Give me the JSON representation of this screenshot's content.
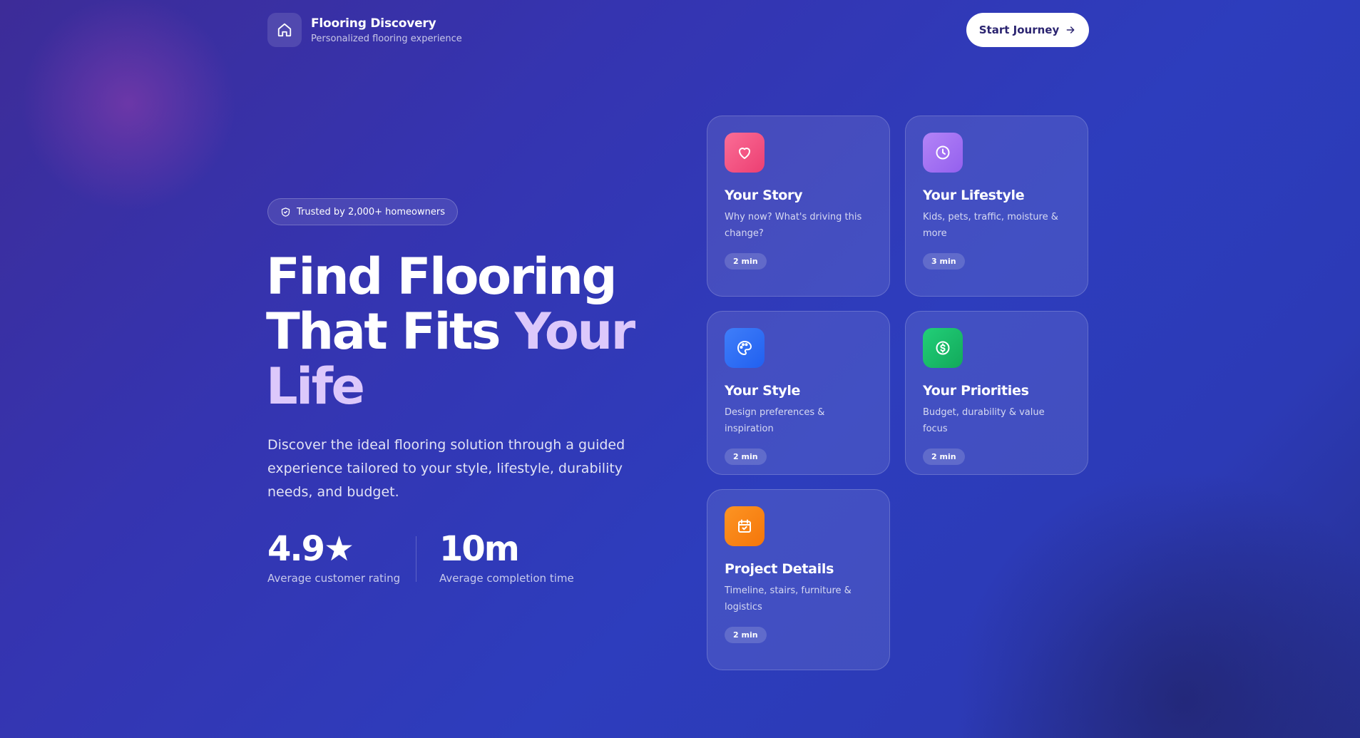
{
  "header": {
    "title": "Flooring Discovery",
    "subtitle": "Personalized flooring experience",
    "cta_label": "Start Journey"
  },
  "hero": {
    "badge": "Trusted by 2,000+ homeowners",
    "title_line1": "Find Flooring",
    "title_line2": "That Fits ",
    "title_accent_1": "Your",
    "title_accent_2": "Life",
    "description": "Discover the ideal flooring solution through a guided experience tailored to your style, lifestyle, durability needs, and budget.",
    "stats": [
      {
        "value": "4.9★",
        "label": "Average customer rating"
      },
      {
        "value": "10m",
        "label": "Average completion time"
      }
    ]
  },
  "cards": [
    {
      "title": "Your Story",
      "description": "Why now? What's driving this change?",
      "time": "2 min",
      "icon": "heart-icon",
      "color": "#f0527f"
    },
    {
      "title": "Your Lifestyle",
      "description": "Kids, pets, traffic, moisture & more",
      "time": "3 min",
      "icon": "clock-icon",
      "color": "#a56ff2"
    },
    {
      "title": "Your Style",
      "description": "Design preferences & inspiration",
      "time": "2 min",
      "icon": "palette-icon",
      "color": "#2d6cf5"
    },
    {
      "title": "Your Priorities",
      "description": "Budget, durability & value focus",
      "time": "2 min",
      "icon": "dollar-icon",
      "color": "#19c06a"
    },
    {
      "title": "Project Details",
      "description": "Timeline, stairs, furniture & logistics",
      "time": "2 min",
      "icon": "calendar-check-icon",
      "color": "#fb8613"
    }
  ]
}
